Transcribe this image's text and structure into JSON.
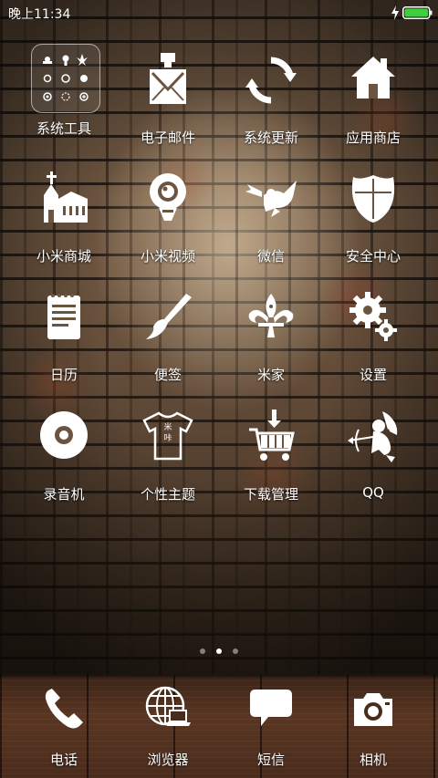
{
  "status_bar": {
    "time": "晚上11:34",
    "battery_color": "#3ecf3e",
    "charging_icon": "lightning-icon",
    "battery_icon": "battery-icon"
  },
  "home": {
    "apps": [
      {
        "label": "系统工具",
        "icon": "folder-icon"
      },
      {
        "label": "电子邮件",
        "icon": "mail-icon"
      },
      {
        "label": "系统更新",
        "icon": "refresh-icon"
      },
      {
        "label": "应用商店",
        "icon": "house-icon"
      },
      {
        "label": "小米商城",
        "icon": "church-icon"
      },
      {
        "label": "小米视频",
        "icon": "camera-eye-icon"
      },
      {
        "label": "微信",
        "icon": "angel-icon"
      },
      {
        "label": "安全中心",
        "icon": "shield-icon"
      },
      {
        "label": "日历",
        "icon": "notepad-icon"
      },
      {
        "label": "便签",
        "icon": "brush-icon"
      },
      {
        "label": "米家",
        "icon": "fleur-de-lis-icon"
      },
      {
        "label": "设置",
        "icon": "gears-icon"
      },
      {
        "label": "录音机",
        "icon": "disc-icon"
      },
      {
        "label": "个性主题",
        "icon": "tshirt-icon"
      },
      {
        "label": "下载管理",
        "icon": "cart-download-icon"
      },
      {
        "label": "QQ",
        "icon": "cupid-icon"
      }
    ],
    "theme_shirt_text": "米\n咔",
    "pages": {
      "count": 3,
      "active": 1
    }
  },
  "dock": {
    "apps": [
      {
        "label": "电话",
        "icon": "phone-icon"
      },
      {
        "label": "浏览器",
        "icon": "globe-laptop-icon"
      },
      {
        "label": "短信",
        "icon": "chat-bubble-icon"
      },
      {
        "label": "相机",
        "icon": "camera-icon"
      }
    ]
  },
  "colors": {
    "icon": "#ffffff",
    "text": "#ffffff"
  }
}
